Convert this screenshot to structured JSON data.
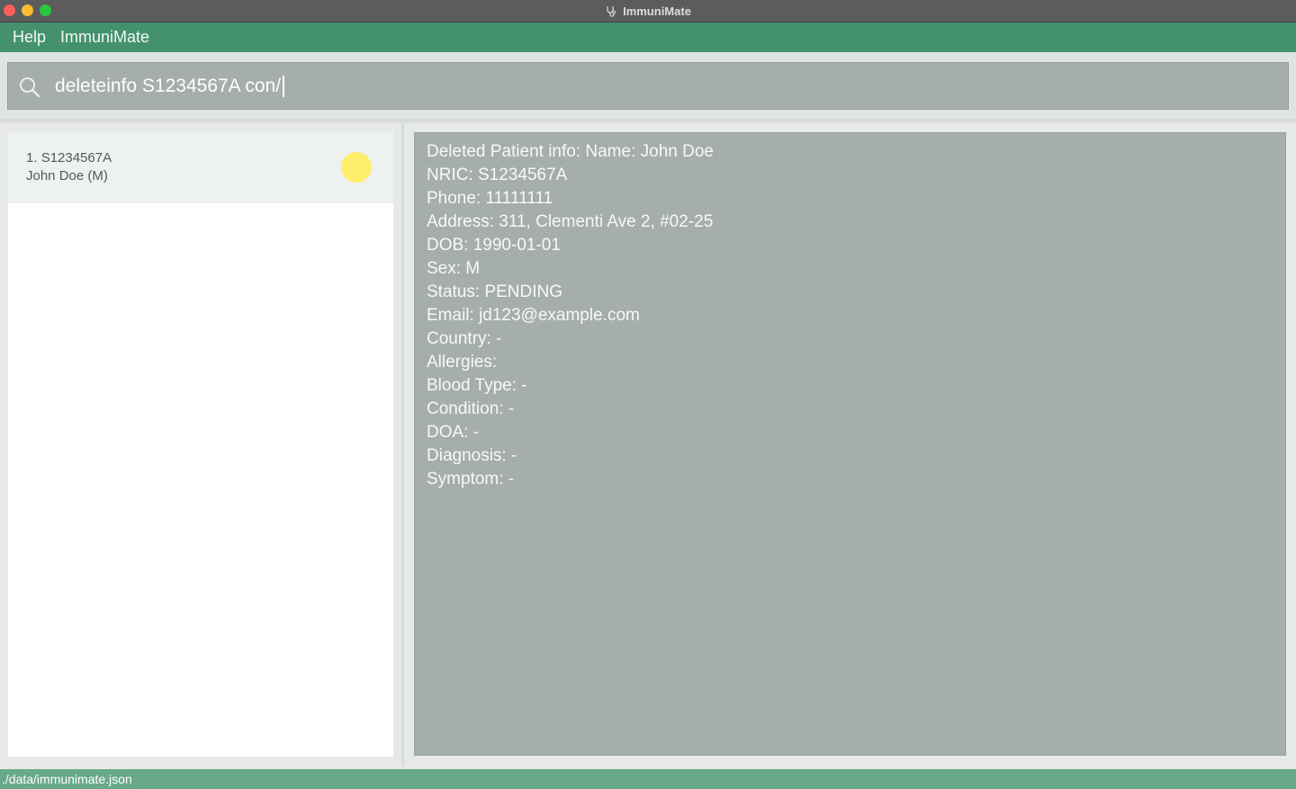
{
  "window": {
    "title": "ImmuniMate",
    "title_icon": "stethoscope-icon"
  },
  "menu": {
    "items": [
      {
        "label": "Help"
      },
      {
        "label": "ImmuniMate"
      }
    ]
  },
  "command": {
    "value": "deleteinfo S1234567A con/",
    "icon": "search-icon"
  },
  "patient_list": {
    "items": [
      {
        "index": "1.",
        "nric": "S1234567A",
        "name": "John Doe (M)",
        "status_color": "#fdee6e"
      }
    ]
  },
  "detail": {
    "lines": [
      "Deleted Patient info: Name: John Doe",
      "NRIC: S1234567A",
      "Phone: 11111111",
      "Address: 311, Clementi Ave 2, #02-25",
      "DOB: 1990-01-01",
      "Sex: M",
      "Status: PENDING",
      "Email: jd123@example.com",
      "Country: -",
      "Allergies:",
      "Blood Type: -",
      "Condition: -",
      "DOA: -",
      "Diagnosis: -",
      "Symptom: -"
    ]
  },
  "status_bar": {
    "path": "./data/immunimate.json"
  },
  "colors": {
    "menubar": "#44926d",
    "statusbar": "#68a98a",
    "panel": "#a5aeab",
    "status_pending": "#fdee6e"
  }
}
